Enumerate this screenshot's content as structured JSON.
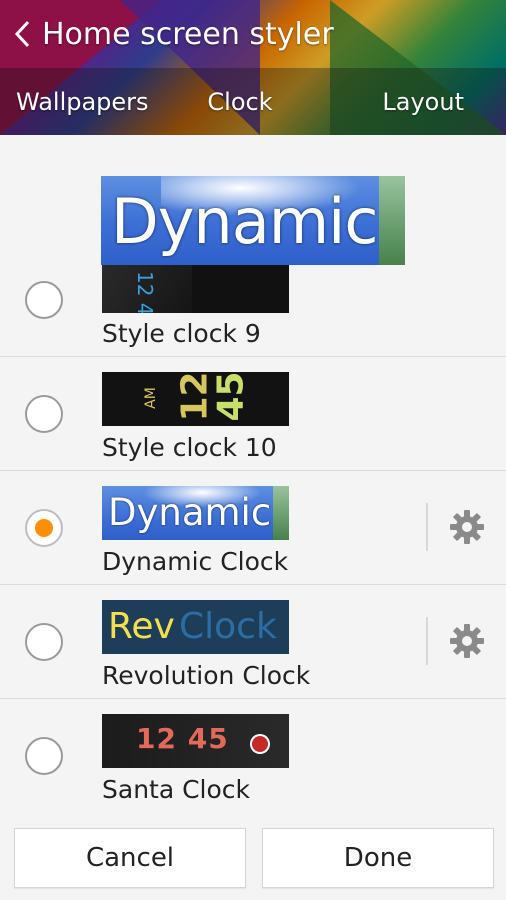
{
  "header": {
    "title": "Home screen styler",
    "tabs": [
      {
        "label": "Wallpapers"
      },
      {
        "label": "Clock"
      },
      {
        "label": "Layout"
      }
    ]
  },
  "clocks": [
    {
      "name": "Style clock 9",
      "selected": false,
      "has_settings": false,
      "thumb_text": "12 45"
    },
    {
      "name": "Style clock 10",
      "selected": false,
      "has_settings": false,
      "thumb_text_am": "AM",
      "thumb_text_h": "12",
      "thumb_text_m": "45"
    },
    {
      "name": "Dynamic Clock",
      "selected": true,
      "has_settings": true,
      "thumb_text": "Dynamic"
    },
    {
      "name": "Revolution Clock",
      "selected": false,
      "has_settings": true,
      "thumb_text_a": "Rev",
      "thumb_text_b": "Clock"
    },
    {
      "name": "Santa Clock",
      "selected": false,
      "has_settings": false,
      "thumb_text": "12 45"
    }
  ],
  "preview": {
    "thumb_text": "Dynamic"
  },
  "footer": {
    "cancel_label": "Cancel",
    "done_label": "Done"
  },
  "colors": {
    "accent": "#ff8f00",
    "tab_text": "#ffffff"
  }
}
